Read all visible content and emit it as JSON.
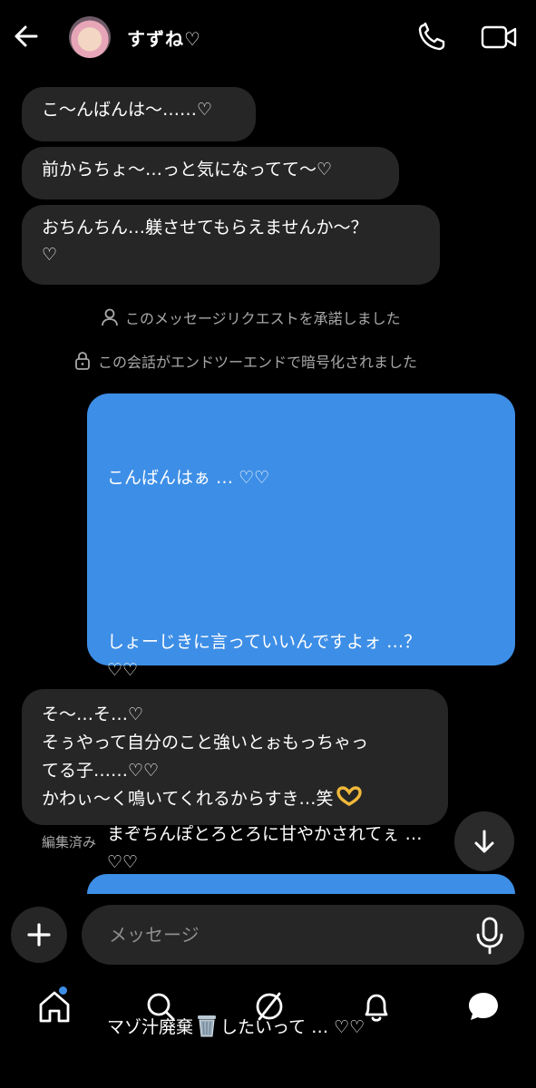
{
  "header": {
    "contact_name": "すずね♡"
  },
  "messages_in_top": [
    "こ～んばんは〜……♡",
    "前からちょ～…っと気になってて〜♡",
    "おちんちん…躾させてもらえませんか～？\n♡"
  ],
  "system_notes": {
    "request_accepted": "このメッセージリクエストを承諾しました",
    "encrypted": "この会話がエンドツーエンドで暗号化されました"
  },
  "message_out": {
    "line1": "こんばんはぁ … ♡♡",
    "line2": "しょーじきに言っていいんですよォ …？\n♡♡",
    "line3": "まぞちんぽとろとろに甘やかされてぇ …\n♡♡",
    "line4_before": "マゾ汁廃棄",
    "line4_after": "したいって … ♡♡"
  },
  "message_in_bottom": {
    "text": "そ～…そ…♡\nそぅやって自分のこと強いとぉもっちゃっ\nてる子……♡♡\nかわぃ〜く鳴いてくれるからすき…笑",
    "edited_label": "編集済み"
  },
  "composer": {
    "placeholder": "メッセージ"
  },
  "icons": {
    "back": "arrow-left-icon",
    "call": "phone-icon",
    "video": "video-camera-icon",
    "trash": "wastebasket-emoji",
    "hands": "heart-hands-emoji",
    "scroll": "arrow-down-icon",
    "plus": "plus-icon",
    "mic": "microphone-icon",
    "home": "home-icon",
    "search": "search-icon",
    "explore": "compass-icon",
    "notifications": "bell-icon",
    "messages": "chat-bubble-icon"
  },
  "colors": {
    "background": "#000000",
    "incoming_bubble": "#262626",
    "outgoing_bubble": "#3d8ee6",
    "secondary_text": "#a8a8a8",
    "notification_dot": "#3d8ee6"
  }
}
